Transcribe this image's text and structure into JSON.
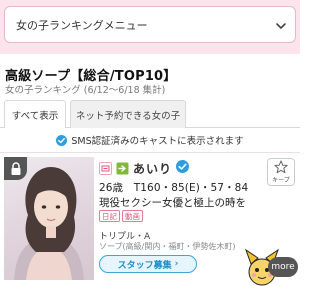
{
  "menu": {
    "label": "女の子ランキングメニュー"
  },
  "page": {
    "title": "高級ソープ【総合/TOP10】",
    "subtitle": "女の子ランキング (6/12〜6/18 集計)"
  },
  "tabs": [
    {
      "label": "すべて表示",
      "active": true
    },
    {
      "label": "ネット予約できる女の子",
      "active": false
    }
  ],
  "sms_note": "SMS認証済みのキャストに表示されます",
  "card": {
    "name": "あいり",
    "stats": "26歳　T160・85(E)・57・84",
    "catch": "現役セクシー女優と極上の時を",
    "tags": [
      "日記",
      "動画"
    ],
    "shop_line": "トリプル・A",
    "area_line": "ソープ(高級/関内・福町・伊勢佐木町)",
    "staff_button": "スタッフ募集",
    "keep_label": "キープ"
  },
  "more_label": "more",
  "colors": {
    "pink_band": "#fde4ec",
    "accent_pink": "#e0557f",
    "accent_blue": "#1c8ec8",
    "verified_blue": "#2b9ee0"
  }
}
